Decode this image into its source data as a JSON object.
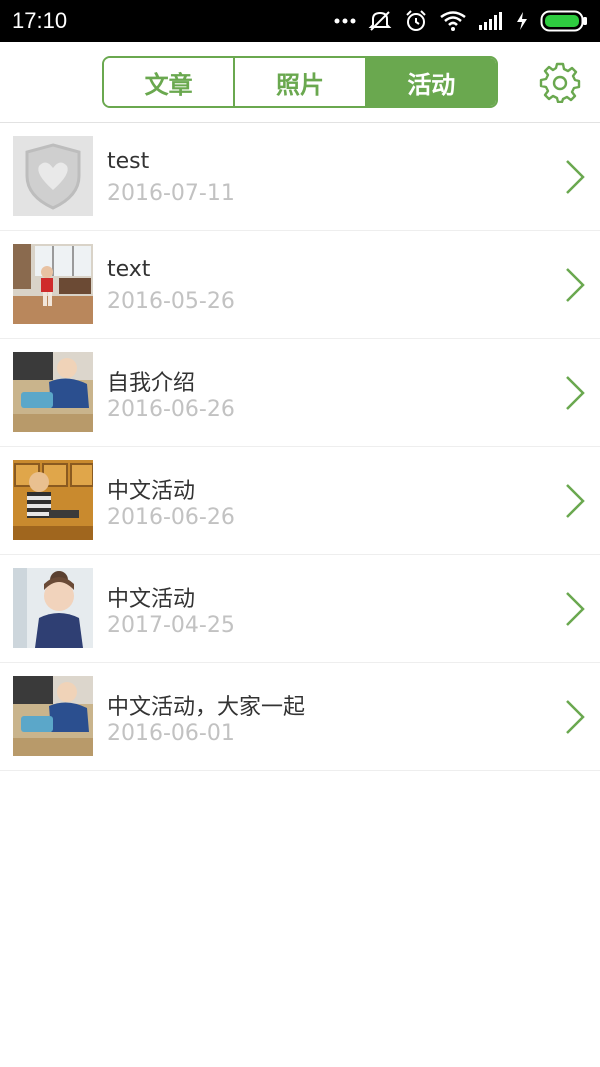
{
  "status_bar": {
    "time": "17:10",
    "icons": [
      "more-dots-icon",
      "mute-icon",
      "alarm-icon",
      "wifi-icon",
      "signal-icon",
      "charging-icon",
      "battery-icon"
    ]
  },
  "tabs": [
    {
      "label": "文章",
      "active": false
    },
    {
      "label": "照片",
      "active": false
    },
    {
      "label": "活动",
      "active": true
    }
  ],
  "settings_icon": "gear-icon",
  "colors": {
    "accent": "#6aa84f",
    "title_text": "#333333",
    "date_text": "#c2c2c2",
    "divider": "#eeeeee"
  },
  "items": [
    {
      "title": "test",
      "date": "2016-07-11",
      "thumbnail": "placeholder-shield-heart-icon"
    },
    {
      "title": "text",
      "date": "2016-05-26",
      "thumbnail": "photo-toddler-red-shirt"
    },
    {
      "title": "自我介绍",
      "date": "2016-06-26",
      "thumbnail": "photo-toddler-playing-tray"
    },
    {
      "title": "中文活动",
      "date": "2016-06-26",
      "thumbnail": "photo-toddler-striped-shirt"
    },
    {
      "title": "中文活动",
      "date": "2017-04-25",
      "thumbnail": "photo-girl-portrait"
    },
    {
      "title": "中文活动，大家一起",
      "date": "2016-06-01",
      "thumbnail": "photo-toddler-playing-tray"
    }
  ]
}
